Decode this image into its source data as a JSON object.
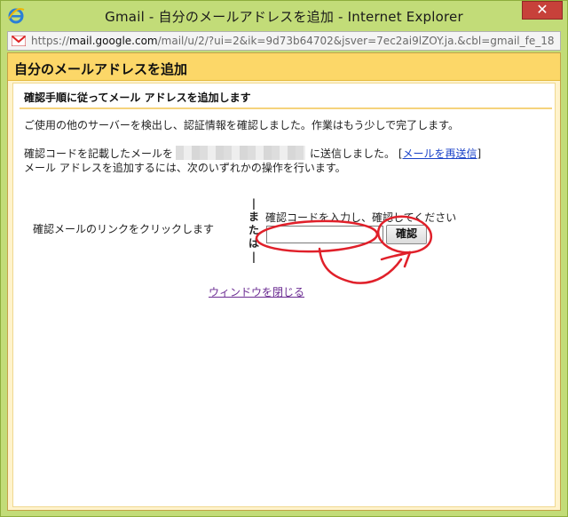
{
  "window": {
    "title": "Gmail - 自分のメールアドレスを追加 - Internet Explorer",
    "close_label": "✕"
  },
  "address_bar": {
    "url_prefix": "https://",
    "url_host": "mail.google.com",
    "url_rest": "/mail/u/2/?ui=2&ik=9d73b64702&jsver=7ec2ai9lZOY.ja.&cbl=gmail_fe_18"
  },
  "page": {
    "header": "自分のメールアドレスを追加",
    "sub_heading": "確認手順に従ってメール アドレスを追加します",
    "intro": "ご使用の他のサーバーを検出し、認証情報を確認しました。作業はもう少しで完了します。",
    "sent_prefix": "確認コードを記載したメールを",
    "sent_suffix": "に送信しました。",
    "resend_open": "[",
    "resend_link": "メールを再送信",
    "resend_close": "]",
    "instruction": "メール アドレスを追加するには、次のいずれかの操作を行います。",
    "option_link_text": "確認メールのリンクをクリックします",
    "or_label": "|\nま\nた\nは\n|",
    "code_prompt": "確認コードを入力し、確認してください",
    "code_value": "",
    "confirm_label": "確認",
    "close_window_link": "ウィンドウを閉じる"
  },
  "colors": {
    "window_frame": "#c2dc78",
    "header_bg": "#fcd768",
    "panel_border": "#f0d890",
    "annotation": "#e0202a"
  },
  "icons": [
    "ie-icon",
    "gmail-icon",
    "close-icon"
  ]
}
